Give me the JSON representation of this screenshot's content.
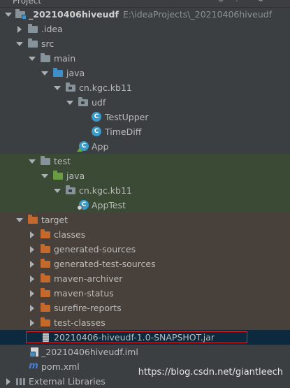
{
  "header": {
    "title": "Project"
  },
  "tree": {
    "project": {
      "name": "_20210406hiveudf",
      "path": "E:\\ideaProjects\\_20210406hiveudf"
    },
    "idea": "idea",
    "src": "src",
    "main": "main",
    "main_java": "java",
    "main_pkg": "cn.kgc.kb11",
    "udf": "udf",
    "test_upper": "TestUpper",
    "time_diff": "TimeDiff",
    "app": "App",
    "test": "test",
    "test_java": "java",
    "test_pkg": "cn.kgc.kb11",
    "app_test": "AppTest",
    "target": "target",
    "classes": "classes",
    "generated_sources": "generated-sources",
    "generated_test_sources": "generated-test-sources",
    "maven_archiver": "maven-archiver",
    "maven_status": "maven-status",
    "surefire_reports": "surefire-reports",
    "test_classes": "test-classes",
    "jar": "20210406-hiveudf-1.0-SNAPSHOT.jar",
    "iml": "_20210406hiveudf.iml",
    "pom": "pom.xml",
    "external_libraries": "External Libraries"
  },
  "icons": {
    "project": "module-folder-icon",
    "folder": "folder-icon",
    "source_root": "source-root-folder-icon",
    "test_root": "test-root-folder-icon",
    "excluded": "excluded-folder-icon",
    "package": "package-icon",
    "class": "class-icon",
    "jar": "jar-file-icon",
    "iml": "module-file-icon",
    "pom": "maven-icon",
    "libraries": "libraries-icon"
  },
  "colors": {
    "background": "#3c3f41",
    "test_row": "#3b4a34",
    "target_row": "#48403a",
    "selected_row": "#0d293e",
    "highlight_box": "#e02a2a"
  },
  "watermark": "https://blog.csdn.net/giantleech"
}
